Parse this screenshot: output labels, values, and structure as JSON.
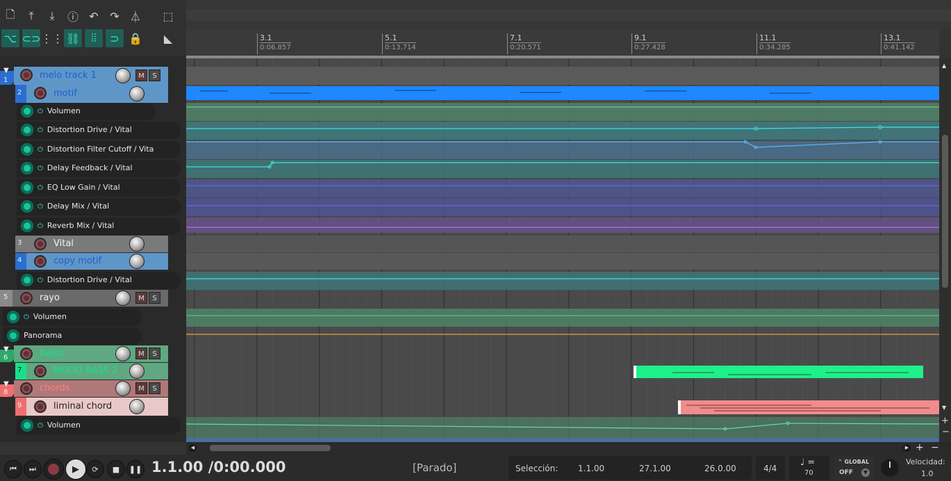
{
  "toolbar": {
    "icons_row1": [
      "new-file-icon",
      "save-icon",
      "download-icon",
      "info-icon",
      "undo-icon",
      "redo-icon",
      "metronome-icon",
      "marquee-icon"
    ],
    "icons_row2": [
      "ripple-edit-icon",
      "link-icon",
      "grid-icon",
      "item-group-icon",
      "snap-grid-icon",
      "loop-snap-icon",
      "lock-icon",
      "trim-icon"
    ]
  },
  "ruler": {
    "marks": [
      {
        "bar": "3.1",
        "time": "0:06.857"
      },
      {
        "bar": "5.1",
        "time": "0:13.714"
      },
      {
        "bar": "7.1",
        "time": "0:20.571"
      },
      {
        "bar": "9.1",
        "time": "0:27.428"
      },
      {
        "bar": "11.1",
        "time": "0:34.285"
      },
      {
        "bar": "13.1",
        "time": "0:41.142"
      }
    ]
  },
  "tracks": {
    "t1": {
      "num": "1",
      "name": "melo track 1",
      "mute": "M",
      "solo": "S",
      "color": "#5b9bd5"
    },
    "t2": {
      "num": "2",
      "name": "motif",
      "color": "#5b9bd5"
    },
    "t3": {
      "num": "3",
      "name": "Vital"
    },
    "t4": {
      "num": "4",
      "name": "copy motif",
      "color": "#2a8ef0"
    },
    "t5": {
      "num": "5",
      "name": "rayo",
      "mute": "M",
      "solo": "S"
    },
    "t6": {
      "num": "6",
      "name": "bajos",
      "mute": "M",
      "solo": "S",
      "color": "#3cb87a"
    },
    "t7": {
      "num": "7",
      "name": "MODO BASS 2",
      "color": "#18e08a"
    },
    "t8": {
      "num": "8",
      "name": "chords",
      "mute": "M",
      "solo": "S",
      "color": "#ef6f6f"
    },
    "t9": {
      "num": "9",
      "name": "liminal chord",
      "color": "#f0a0a0"
    }
  },
  "envelopes": {
    "e1": "Volumen",
    "e2": "Distortion Drive / Vital",
    "e3": "Distortion Filter Cutoff / Vita",
    "e4": "Delay Feedback / Vital",
    "e5": "EQ Low Gain / Vital",
    "e6": "Delay Mix / Vital",
    "e7": "Reverb Mix / Vital",
    "e8": "Distortion Drive / Vital",
    "e9": "Volumen",
    "e10": "Panorama",
    "e11": "Volumen"
  },
  "transport": {
    "position": "1.1.00 /0:00.000",
    "status": "[Parado]",
    "selection_label": "Selección:",
    "sel_start": "1.1.00",
    "sel_end": "27.1.00",
    "sel_length": "26.0.00",
    "time_sig": "4/4",
    "tempo_symbol": "♩ =",
    "tempo": "70",
    "global_label": "GLOBAL",
    "global_state": "OFF",
    "rate_label": "Velocidad:",
    "rate": "1.0"
  },
  "colors": {
    "teal": "#3fe0c8",
    "blue_item": "#1e88ff",
    "green_item": "#1ef08a",
    "red_item": "#f08c8c"
  }
}
